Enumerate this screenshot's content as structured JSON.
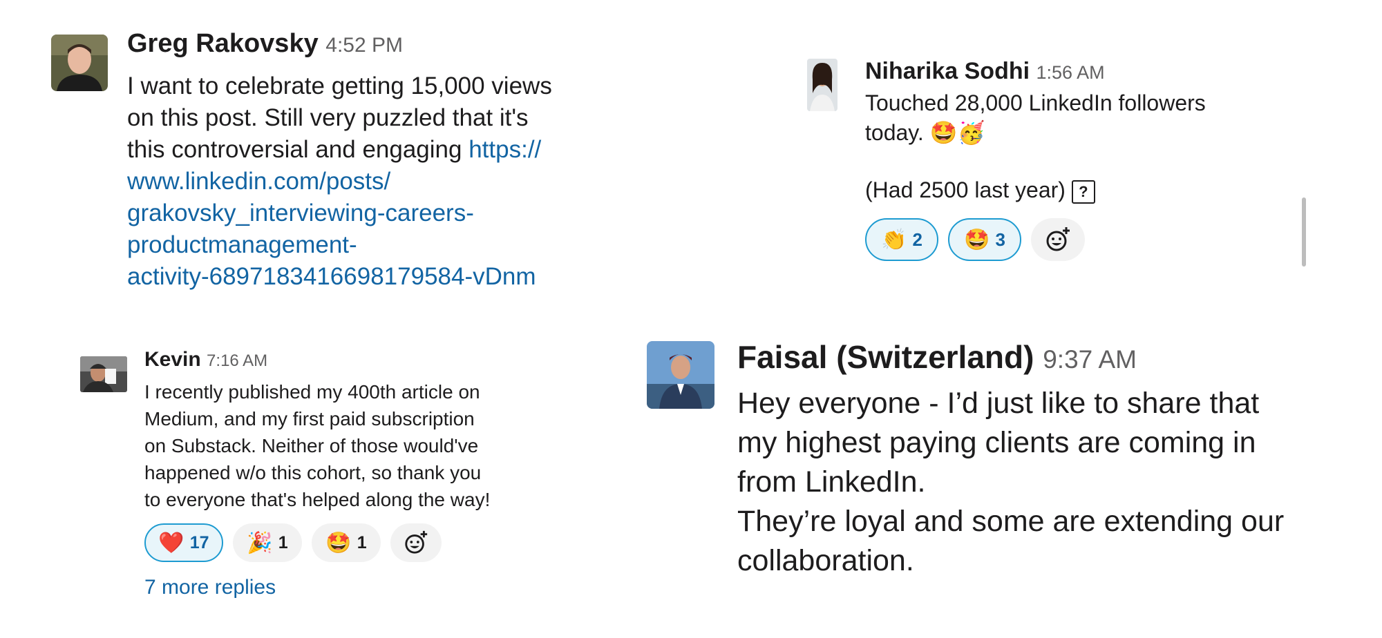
{
  "messages": {
    "greg": {
      "author": "Greg Rakovsky",
      "time": "4:52 PM",
      "text": "I want to celebrate getting 15,000 views\non this post. Still very puzzled that it's\nthis controversial and engaging ",
      "link": "https://\nwww.linkedin.com/posts/\ngrakovsky_interviewing-careers-\nproductmanagement-\nactivity-6897183416698179584-vDnm"
    },
    "niharika": {
      "author": "Niharika Sodhi",
      "time": "1:56 AM",
      "text": "Touched 28,000 LinkedIn followers\ntoday. 🤩🥳",
      "text2": "(Had 2500 last year)",
      "placeholder_glyph": "?",
      "reactions": [
        {
          "emoji": "👏",
          "count": "2",
          "active": true
        },
        {
          "emoji": "🤩",
          "count": "3",
          "active": true
        }
      ],
      "add_reaction_icon": "add-emoji-icon"
    },
    "kevin": {
      "author": "Kevin",
      "time": "7:16 AM",
      "text": "I recently published my 400th article on\nMedium, and my first paid subscription\non Substack. Neither of those would've\nhappened w/o this cohort, so thank you\nto everyone that's helped along the way!",
      "reactions": [
        {
          "emoji": "❤️",
          "count": "17",
          "active": true
        },
        {
          "emoji": "🎉",
          "count": "1",
          "active": false
        },
        {
          "emoji": "🤩",
          "count": "1",
          "active": false
        }
      ],
      "add_reaction_icon": "add-emoji-icon",
      "more_replies": "7 more replies"
    },
    "faisal": {
      "author": "Faisal (Switzerland)",
      "time": "9:37 AM",
      "text": "Hey everyone - I’d just like to share that\nmy highest paying clients are coming in\nfrom LinkedIn.\nThey’re loyal and some are extending our\ncollaboration."
    }
  },
  "colors": {
    "link": "#1264a3",
    "reaction_active_bg": "#e8f5fa",
    "reaction_active_border": "#1d9bd1",
    "timestamp": "#616061"
  }
}
